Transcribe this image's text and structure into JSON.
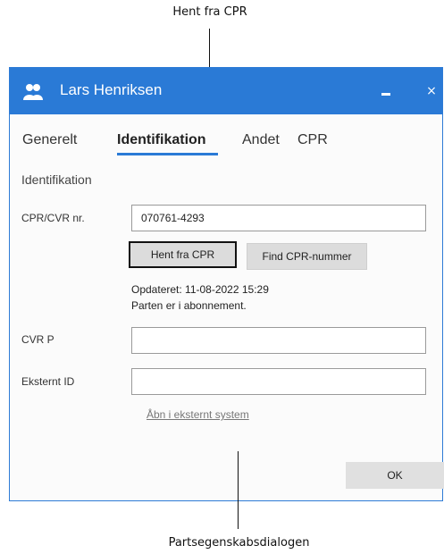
{
  "callouts": {
    "top": "Hent fra CPR",
    "bottom": "Partsegenskabsdialogen"
  },
  "window": {
    "title": "Lars Henriksen",
    "title_icon": "people-icon",
    "accent_color": "#2a7ad6",
    "close_glyph": "×"
  },
  "tabs": [
    {
      "label": "Generelt",
      "active": false
    },
    {
      "label": "Identifikation",
      "active": true
    },
    {
      "label": "Andet",
      "active": false
    },
    {
      "label": "CPR",
      "active": false
    }
  ],
  "section": {
    "title": "Identifikation"
  },
  "form": {
    "cpr_label": "CPR/CVR nr.",
    "cpr_value": "070761-4293",
    "hent_button": "Hent fra CPR",
    "find_button": "Find CPR-nummer",
    "updated_text": "Opdateret: 11-08-2022 15:29",
    "subscription_text": "Parten er i abonnement.",
    "cvrp_label": "CVR P",
    "cvrp_value": "",
    "external_id_label": "Eksternt ID",
    "external_id_value": "",
    "open_external_link": "Åbn i eksternt system"
  },
  "footer": {
    "ok_button": "OK"
  }
}
